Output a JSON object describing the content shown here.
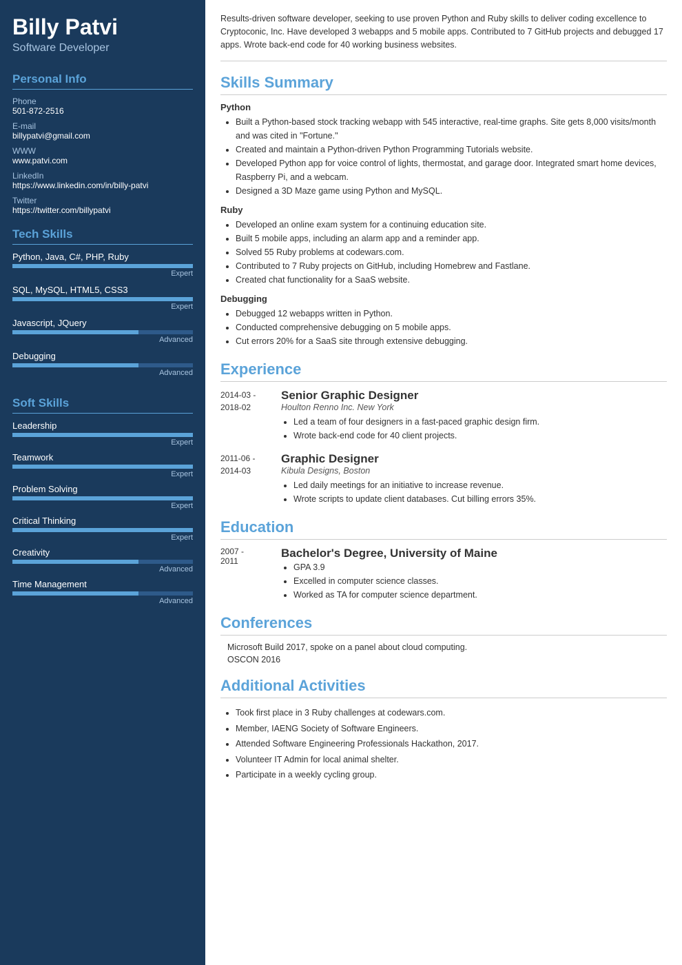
{
  "sidebar": {
    "name": "Billy Patvi",
    "title": "Software Developer",
    "sections": {
      "personal_info": {
        "title": "Personal Info",
        "fields": [
          {
            "label": "Phone",
            "value": "501-872-2516"
          },
          {
            "label": "E-mail",
            "value": "billypatvi@gmail.com"
          },
          {
            "label": "WWW",
            "value": "www.patvi.com"
          },
          {
            "label": "LinkedIn",
            "value": "https://www.linkedin.com/in/billy-patvi"
          },
          {
            "label": "Twitter",
            "value": "https://twitter.com/billypatvi"
          }
        ]
      },
      "tech_skills": {
        "title": "Tech Skills",
        "items": [
          {
            "name": "Python, Java, C#, PHP, Ruby",
            "level": "Expert",
            "pct": 100
          },
          {
            "name": "SQL, MySQL, HTML5, CSS3",
            "level": "Expert",
            "pct": 100
          },
          {
            "name": "Javascript, JQuery",
            "level": "Advanced",
            "pct": 70
          },
          {
            "name": "Debugging",
            "level": "Advanced",
            "pct": 70
          }
        ]
      },
      "soft_skills": {
        "title": "Soft Skills",
        "items": [
          {
            "name": "Leadership",
            "level": "Expert",
            "pct": 100
          },
          {
            "name": "Teamwork",
            "level": "Expert",
            "pct": 100
          },
          {
            "name": "Problem Solving",
            "level": "Expert",
            "pct": 100
          },
          {
            "name": "Critical Thinking",
            "level": "Expert",
            "pct": 100
          },
          {
            "name": "Creativity",
            "level": "Advanced",
            "pct": 70
          },
          {
            "name": "Time Management",
            "level": "Advanced",
            "pct": 70
          }
        ]
      }
    }
  },
  "main": {
    "summary": "Results-driven software developer, seeking to use proven Python and Ruby skills to deliver coding excellence to Cryptoconic, Inc. Have developed 3 webapps and 5 mobile apps. Contributed to 7 GitHub projects and debugged 17 apps. Wrote back-end code for 40 working business websites.",
    "skills_summary": {
      "title": "Skills Summary",
      "categories": [
        {
          "name": "Python",
          "items": [
            "Built a Python-based stock tracking webapp with 545 interactive, real-time graphs. Site gets 8,000 visits/month and was cited in \"Fortune.\"",
            "Created and maintain a Python-driven Python Programming Tutorials website.",
            "Developed Python app for voice control of lights, thermostat, and garage door. Integrated smart home devices, Raspberry Pi, and a webcam.",
            "Designed a 3D Maze game using Python and MySQL."
          ]
        },
        {
          "name": "Ruby",
          "items": [
            "Developed an online exam system for a continuing education site.",
            "Built 5 mobile apps, including an alarm app and a reminder app.",
            "Solved 55 Ruby problems at codewars.com.",
            "Contributed to 7 Ruby projects on GitHub, including Homebrew and Fastlane.",
            "Created chat functionality for a SaaS website."
          ]
        },
        {
          "name": "Debugging",
          "items": [
            "Debugged 12 webapps written in Python.",
            "Conducted comprehensive debugging on 5 mobile apps.",
            "Cut errors 20% for a SaaS site through extensive debugging."
          ]
        }
      ]
    },
    "experience": {
      "title": "Experience",
      "entries": [
        {
          "dates": "2014-03 -\n2018-02",
          "job_title": "Senior Graphic Designer",
          "company": "Houlton Renno Inc. New York",
          "items": [
            "Led a team of four designers in a fast-paced graphic design firm.",
            "Wrote back-end code for 40 client projects."
          ]
        },
        {
          "dates": "2011-06 -\n2014-03",
          "job_title": "Graphic Designer",
          "company": "Kibula Designs, Boston",
          "items": [
            "Led daily meetings for an initiative to increase revenue.",
            "Wrote scripts to update client databases. Cut billing errors 35%."
          ]
        }
      ]
    },
    "education": {
      "title": "Education",
      "entries": [
        {
          "dates": "2007 -\n2011",
          "degree": "Bachelor's Degree, University of Maine",
          "items": [
            "GPA 3.9",
            "Excelled in computer science classes.",
            "Worked as TA for computer science department."
          ]
        }
      ]
    },
    "conferences": {
      "title": "Conferences",
      "items": [
        "Microsoft Build 2017, spoke on a panel about cloud computing.",
        "OSCON 2016"
      ]
    },
    "additional": {
      "title": "Additional Activities",
      "items": [
        "Took first place in 3 Ruby challenges at codewars.com.",
        "Member, IAENG Society of Software Engineers.",
        "Attended Software Engineering Professionals Hackathon, 2017.",
        "Volunteer IT Admin for local animal shelter.",
        "Participate in a weekly cycling group."
      ]
    }
  }
}
